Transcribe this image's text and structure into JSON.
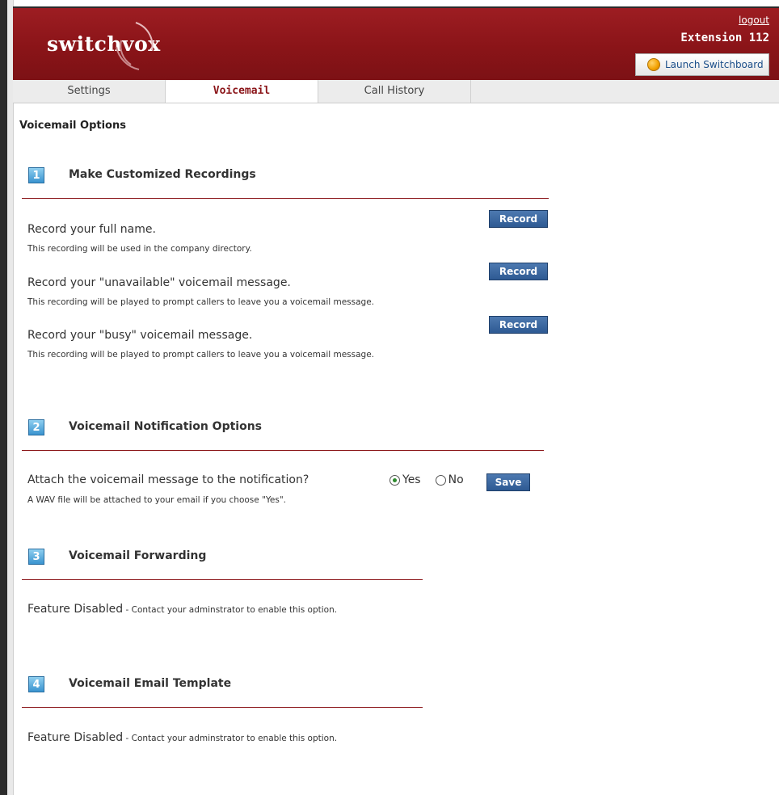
{
  "header": {
    "logo_text": "switchvox",
    "logout_label": "logout",
    "extension_label": "Extension 112",
    "launch_label": "Launch Switchboard"
  },
  "tabs": [
    {
      "label": "Settings",
      "active": false
    },
    {
      "label": "Voicemail",
      "active": true
    },
    {
      "label": "Call History",
      "active": false
    }
  ],
  "page_title": "Voicemail Options",
  "sections": {
    "recordings": {
      "number": "1",
      "title": "Make Customized Recordings",
      "items": [
        {
          "text": "Record your full name.",
          "sub": "This recording will be used in the company directory.",
          "button": "Record"
        },
        {
          "text": "Record your \"unavailable\" voicemail message.",
          "sub": "This recording will be played to prompt callers to leave you a voicemail message.",
          "button": "Record"
        },
        {
          "text": "Record your \"busy\" voicemail message.",
          "sub": "This recording will be played to prompt callers to leave you a voicemail message.",
          "button": "Record"
        }
      ]
    },
    "notification": {
      "number": "2",
      "title": "Voicemail Notification Options",
      "question": "Attach the voicemail message to the notification?",
      "sub": "A WAV file will be attached to your email if you choose \"Yes\".",
      "yes_label": "Yes",
      "no_label": "No",
      "selected": "Yes",
      "save_label": "Save"
    },
    "forwarding": {
      "number": "3",
      "title": "Voicemail Forwarding",
      "status": "Feature Disabled",
      "note": " - Contact your adminstrator to enable this option."
    },
    "email_template": {
      "number": "4",
      "title": "Voicemail Email Template",
      "status": "Feature Disabled",
      "note": " - Contact your adminstrator to enable this option."
    }
  },
  "colors": {
    "header_red": "#8a1418",
    "button_blue": "#2e5a93",
    "badge_blue": "#3a93cf"
  }
}
